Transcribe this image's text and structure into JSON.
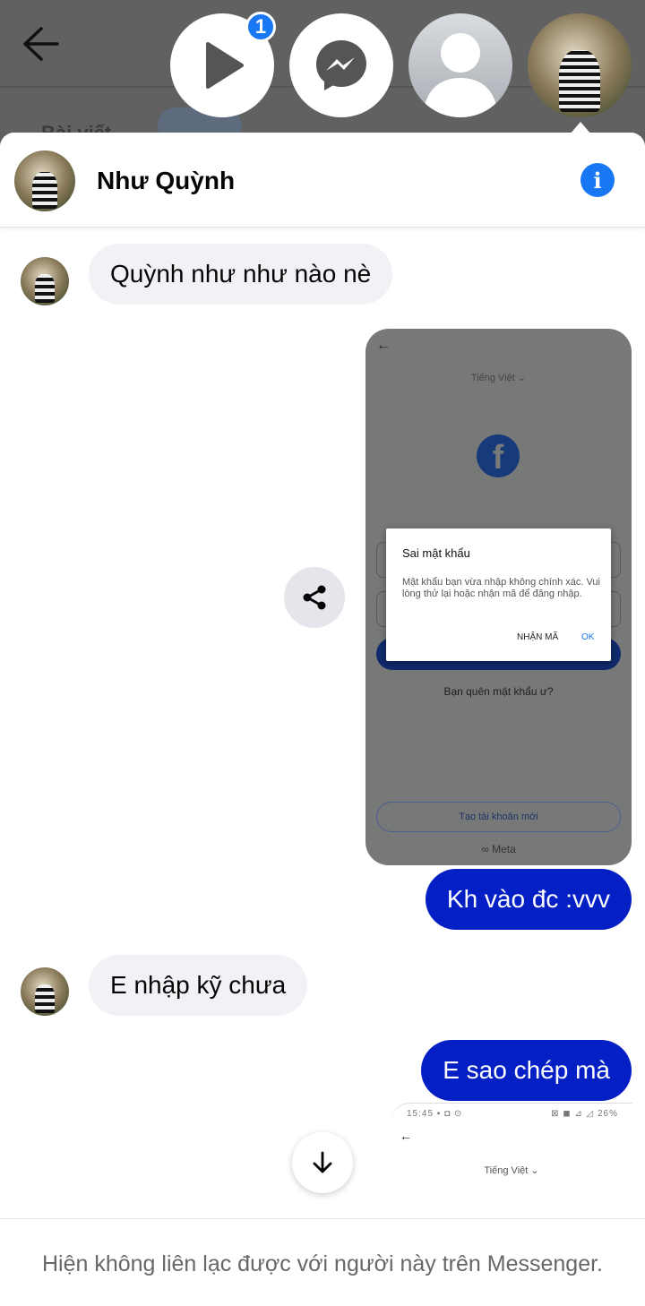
{
  "background": {
    "tab_text": "Bài viết"
  },
  "chat_heads": {
    "play_badge": "1",
    "items": [
      "play-video-head",
      "messenger-head",
      "blank-profile-head",
      "contact-head"
    ]
  },
  "conversation": {
    "contact_name": "Như Quỳnh",
    "info_icon_glyph": "i"
  },
  "messages": {
    "m1": "Quỳnh như như nào nè",
    "m2": "Kh vào đc :vvv",
    "m3": "E nhập kỹ chưa",
    "m4": "E sao chép mà"
  },
  "attachment": {
    "back_glyph": "←",
    "language": "Tiếng Việt ⌄",
    "fb_logo": "f",
    "dialog_title": "Sai mật khẩu",
    "dialog_body": "Mật khẩu bạn vừa nhập không chính xác. Vui lòng thử lại hoặc nhận mã để đăng nhập.",
    "dialog_btn_code": "NHẬN MÃ",
    "dialog_btn_ok": "OK",
    "forgot_password": "Bạn quên mật khẩu ư?",
    "create_account": "Tạo tài khoản mới",
    "meta_label": "∞ Meta"
  },
  "attachment2": {
    "status_left": "15:45 ▪ ◘ ⊙",
    "status_right": "⊠ ◼ ⊿ ◿ 26%",
    "back_glyph": "←",
    "language": "Tiếng Việt ⌄"
  },
  "footer": {
    "notice": "Hiện không liên lạc được với người này trên Messenger."
  },
  "colors": {
    "accent": "#1877f2",
    "outgoing_bubble": "#0420c4",
    "incoming_bubble": "#f0f2f5"
  }
}
